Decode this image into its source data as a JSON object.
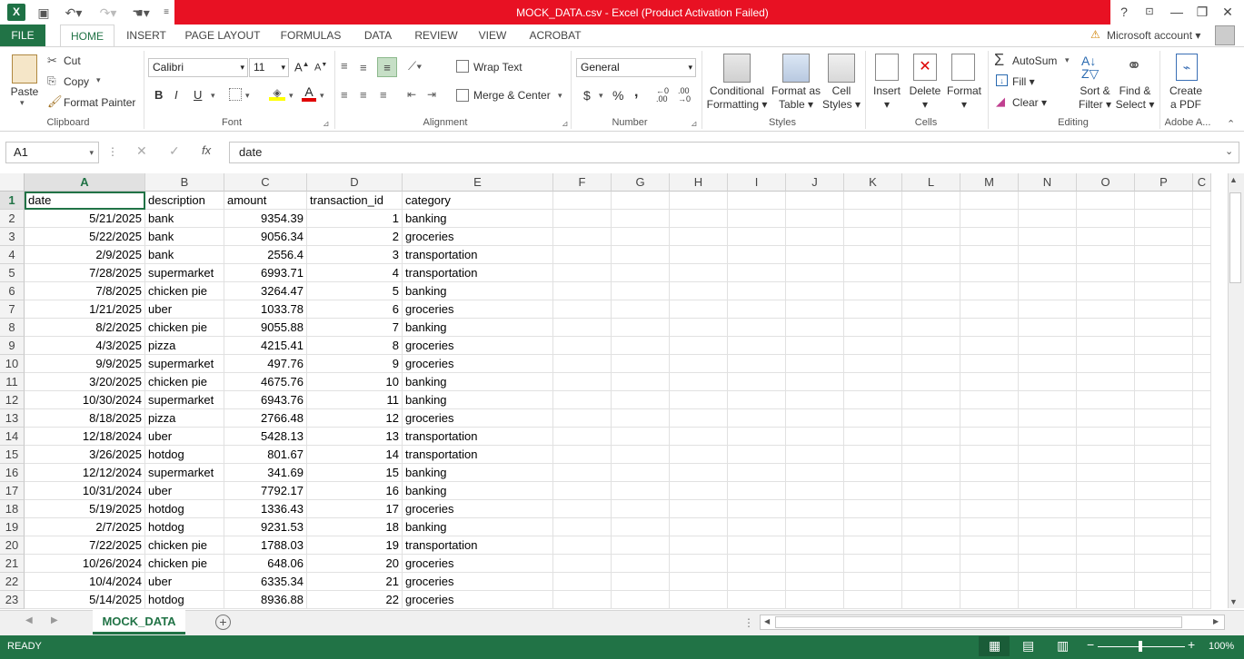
{
  "window": {
    "title": "MOCK_DATA.csv -  Excel (Product Activation Failed)",
    "help": "?",
    "minimize": "—",
    "restore": "❐",
    "close": "✕"
  },
  "tabs": [
    "FILE",
    "HOME",
    "INSERT",
    "PAGE LAYOUT",
    "FORMULAS",
    "DATA",
    "REVIEW",
    "VIEW",
    "ACROBAT"
  ],
  "account": "Microsoft account",
  "ribbon": {
    "clipboard": {
      "paste": "Paste",
      "cut": "Cut",
      "copy": "Copy",
      "format_painter": "Format Painter",
      "label": "Clipboard"
    },
    "font": {
      "name": "Calibri",
      "size": "11",
      "label": "Font",
      "bold": "B",
      "italic": "I",
      "underline": "U"
    },
    "alignment": {
      "wrap": "Wrap Text",
      "merge": "Merge & Center",
      "label": "Alignment"
    },
    "number": {
      "format": "General",
      "currency": "$",
      "percent": "%",
      "comma": ",",
      "label": "Number"
    },
    "styles": {
      "conditional_1": "Conditional",
      "conditional_2": "Formatting",
      "format_table_1": "Format as",
      "format_table_2": "Table",
      "cell_styles_1": "Cell",
      "cell_styles_2": "Styles",
      "label": "Styles"
    },
    "cells": {
      "insert": "Insert",
      "delete": "Delete",
      "format": "Format",
      "label": "Cells"
    },
    "editing": {
      "autosum": "AutoSum",
      "fill": "Fill",
      "clear": "Clear",
      "sort_1": "Sort &",
      "sort_2": "Filter",
      "find_1": "Find &",
      "find_2": "Select",
      "label": "Editing"
    },
    "adobe": {
      "create_1": "Create",
      "create_2": "a PDF",
      "label": "Adobe A..."
    }
  },
  "formula_bar": {
    "name_box": "A1",
    "fx": "fx",
    "value": "date"
  },
  "columns": [
    "A",
    "B",
    "C",
    "D",
    "E",
    "F",
    "G",
    "H",
    "I",
    "J",
    "K",
    "L",
    "M",
    "N",
    "O",
    "P",
    "C"
  ],
  "rows": [
    {
      "n": "1",
      "date": "date",
      "description": "description",
      "amount": "amount",
      "id": "transaction_id",
      "category": "category"
    },
    {
      "n": "2",
      "date": "5/21/2025",
      "description": "bank",
      "amount": "9354.39",
      "id": "1",
      "category": "banking"
    },
    {
      "n": "3",
      "date": "5/22/2025",
      "description": "bank",
      "amount": "9056.34",
      "id": "2",
      "category": "groceries"
    },
    {
      "n": "4",
      "date": "2/9/2025",
      "description": "bank",
      "amount": "2556.4",
      "id": "3",
      "category": "transportation"
    },
    {
      "n": "5",
      "date": "7/28/2025",
      "description": "supermarket",
      "amount": "6993.71",
      "id": "4",
      "category": "transportation"
    },
    {
      "n": "6",
      "date": "7/8/2025",
      "description": "chicken pie",
      "amount": "3264.47",
      "id": "5",
      "category": "banking"
    },
    {
      "n": "7",
      "date": "1/21/2025",
      "description": "uber",
      "amount": "1033.78",
      "id": "6",
      "category": "groceries"
    },
    {
      "n": "8",
      "date": "8/2/2025",
      "description": "chicken pie",
      "amount": "9055.88",
      "id": "7",
      "category": "banking"
    },
    {
      "n": "9",
      "date": "4/3/2025",
      "description": "pizza",
      "amount": "4215.41",
      "id": "8",
      "category": "groceries"
    },
    {
      "n": "10",
      "date": "9/9/2025",
      "description": "supermarket",
      "amount": "497.76",
      "id": "9",
      "category": "groceries"
    },
    {
      "n": "11",
      "date": "3/20/2025",
      "description": "chicken pie",
      "amount": "4675.76",
      "id": "10",
      "category": "banking"
    },
    {
      "n": "12",
      "date": "10/30/2024",
      "description": "supermarket",
      "amount": "6943.76",
      "id": "11",
      "category": "banking"
    },
    {
      "n": "13",
      "date": "8/18/2025",
      "description": "pizza",
      "amount": "2766.48",
      "id": "12",
      "category": "groceries"
    },
    {
      "n": "14",
      "date": "12/18/2024",
      "description": "uber",
      "amount": "5428.13",
      "id": "13",
      "category": "transportation"
    },
    {
      "n": "15",
      "date": "3/26/2025",
      "description": "hotdog",
      "amount": "801.67",
      "id": "14",
      "category": "transportation"
    },
    {
      "n": "16",
      "date": "12/12/2024",
      "description": "supermarket",
      "amount": "341.69",
      "id": "15",
      "category": "banking"
    },
    {
      "n": "17",
      "date": "10/31/2024",
      "description": "uber",
      "amount": "7792.17",
      "id": "16",
      "category": "banking"
    },
    {
      "n": "18",
      "date": "5/19/2025",
      "description": "hotdog",
      "amount": "1336.43",
      "id": "17",
      "category": "groceries"
    },
    {
      "n": "19",
      "date": "2/7/2025",
      "description": "hotdog",
      "amount": "9231.53",
      "id": "18",
      "category": "banking"
    },
    {
      "n": "20",
      "date": "7/22/2025",
      "description": "chicken pie",
      "amount": "1788.03",
      "id": "19",
      "category": "transportation"
    },
    {
      "n": "21",
      "date": "10/26/2024",
      "description": "chicken pie",
      "amount": "648.06",
      "id": "20",
      "category": "groceries"
    },
    {
      "n": "22",
      "date": "10/4/2024",
      "description": "uber",
      "amount": "6335.34",
      "id": "21",
      "category": "groceries"
    },
    {
      "n": "23",
      "date": "5/14/2025",
      "description": "hotdog",
      "amount": "8936.88",
      "id": "22",
      "category": "groceries"
    }
  ],
  "sheet_tab": "MOCK_DATA",
  "status": {
    "ready": "READY",
    "zoom": "100%"
  },
  "colors": {
    "brand": "#217346",
    "title_bar": "#e81123"
  }
}
